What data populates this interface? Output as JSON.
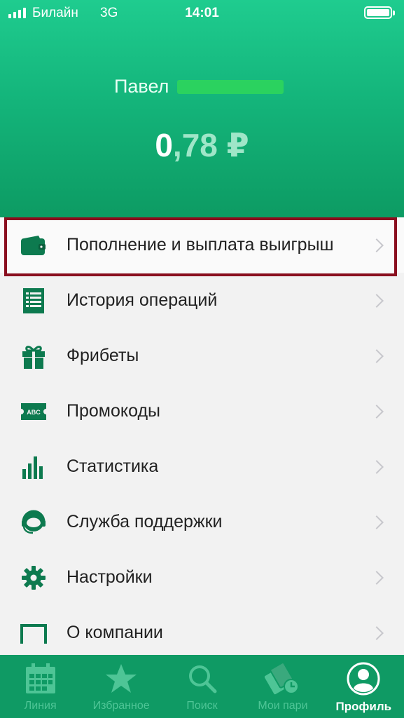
{
  "status_bar": {
    "carrier": "Билайн",
    "network": "3G",
    "time": "14:01"
  },
  "profile": {
    "name": "Павел",
    "balance_int": "0",
    "balance_frac": ",78 ₽"
  },
  "menu": {
    "items": [
      {
        "label": "Пополнение и выплата выигрыш",
        "icon": "wallet-icon"
      },
      {
        "label": "История операций",
        "icon": "receipt-icon"
      },
      {
        "label": "Фрибеты",
        "icon": "gift-icon"
      },
      {
        "label": "Промокоды",
        "icon": "ticket-abc-icon"
      },
      {
        "label": "Статистика",
        "icon": "bar-chart-icon"
      },
      {
        "label": "Служба поддержки",
        "icon": "support-headset-icon"
      },
      {
        "label": "Настройки",
        "icon": "gear-icon"
      },
      {
        "label": "О компании",
        "icon": "company-icon"
      }
    ],
    "icon_badge_text": "ABC"
  },
  "tabbar": {
    "tabs": [
      {
        "label": "Линия",
        "icon": "calendar-icon"
      },
      {
        "label": "Избранное",
        "icon": "star-icon"
      },
      {
        "label": "Поиск",
        "icon": "search-icon"
      },
      {
        "label": "Мои пари",
        "icon": "bets-icon"
      },
      {
        "label": "Профиль",
        "icon": "profile-icon"
      }
    ],
    "active_index": 4
  },
  "colors": {
    "header_green": "#14b57b",
    "tabbar_green": "#0f9a64",
    "icon_green": "#0d7a4f",
    "highlight_frame": "#8a0f1f",
    "name_redaction": "#2bd25f"
  }
}
